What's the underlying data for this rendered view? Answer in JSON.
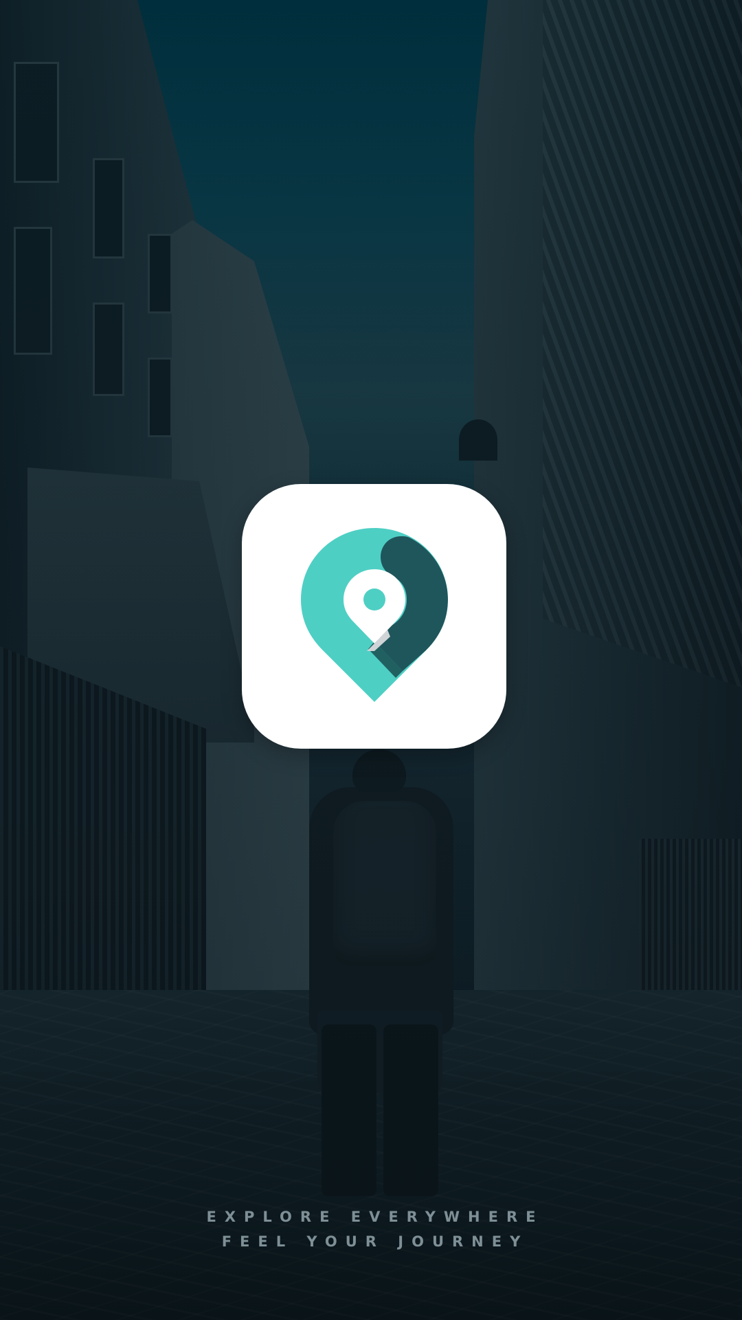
{
  "splash": {
    "background_image": "city-street-traveler-photo",
    "logo_icon": "map-pin-icon",
    "brand_colors": {
      "pin_primary": "#4ecfc4",
      "pin_secondary": "#1f565c",
      "tile_background": "#ffffff"
    },
    "tagline_line1": "EXPLORE EVERYWHERE",
    "tagline_line2": "FEEL YOUR JOURNEY"
  }
}
